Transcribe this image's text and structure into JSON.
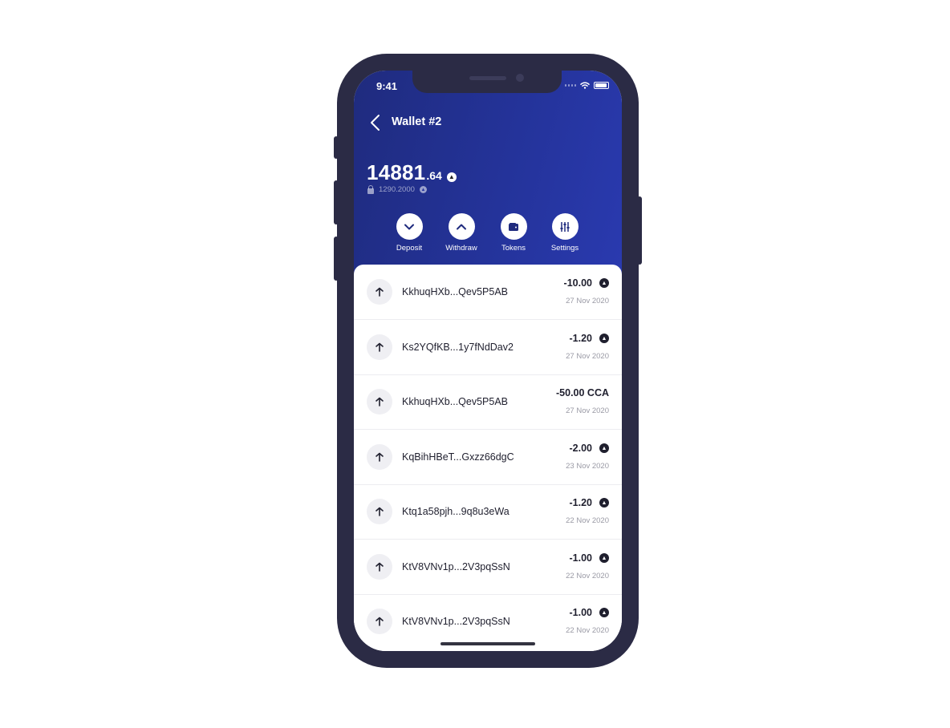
{
  "status_bar": {
    "time": "9:41"
  },
  "header": {
    "title": "Wallet #2",
    "back_icon": "chevron-left-icon"
  },
  "balance": {
    "integer": "14881",
    "decimal": ".64",
    "locked": "1290.2000",
    "coin_icon": "coin-icon"
  },
  "actions": [
    {
      "label": "Deposit",
      "icon": "chevron-down-icon"
    },
    {
      "label": "Withdraw",
      "icon": "chevron-up-icon"
    },
    {
      "label": "Tokens",
      "icon": "wallet-icon"
    },
    {
      "label": "Settings",
      "icon": "sliders-icon"
    }
  ],
  "transactions": [
    {
      "address": "KkhuqHXb...Qev5P5AB",
      "amount": "-10.00",
      "date": "27 Nov 2020",
      "coin": true
    },
    {
      "address": "Ks2YQfKB...1y7fNdDav2",
      "amount": "-1.20",
      "date": "27 Nov 2020",
      "coin": true
    },
    {
      "address": "KkhuqHXb...Qev5P5AB",
      "amount": "-50.00 CCA",
      "date": "27 Nov 2020",
      "coin": false
    },
    {
      "address": "KqBihHBeT...Gxzz66dgC",
      "amount": "-2.00",
      "date": "23 Nov 2020",
      "coin": true
    },
    {
      "address": "Ktq1a58pjh...9q8u3eWa",
      "amount": "-1.20",
      "date": "22 Nov 2020",
      "coin": true
    },
    {
      "address": "KtV8VNv1p...2V3pqSsN",
      "amount": "-1.00",
      "date": "22 Nov 2020",
      "coin": true
    },
    {
      "address": "KtV8VNv1p...2V3pqSsN",
      "amount": "-1.00",
      "date": "22 Nov 2020",
      "coin": true
    }
  ],
  "colors": {
    "header_start": "#1f2b7e",
    "header_end": "#2a3ab0",
    "phone_frame": "#2b2b45"
  }
}
